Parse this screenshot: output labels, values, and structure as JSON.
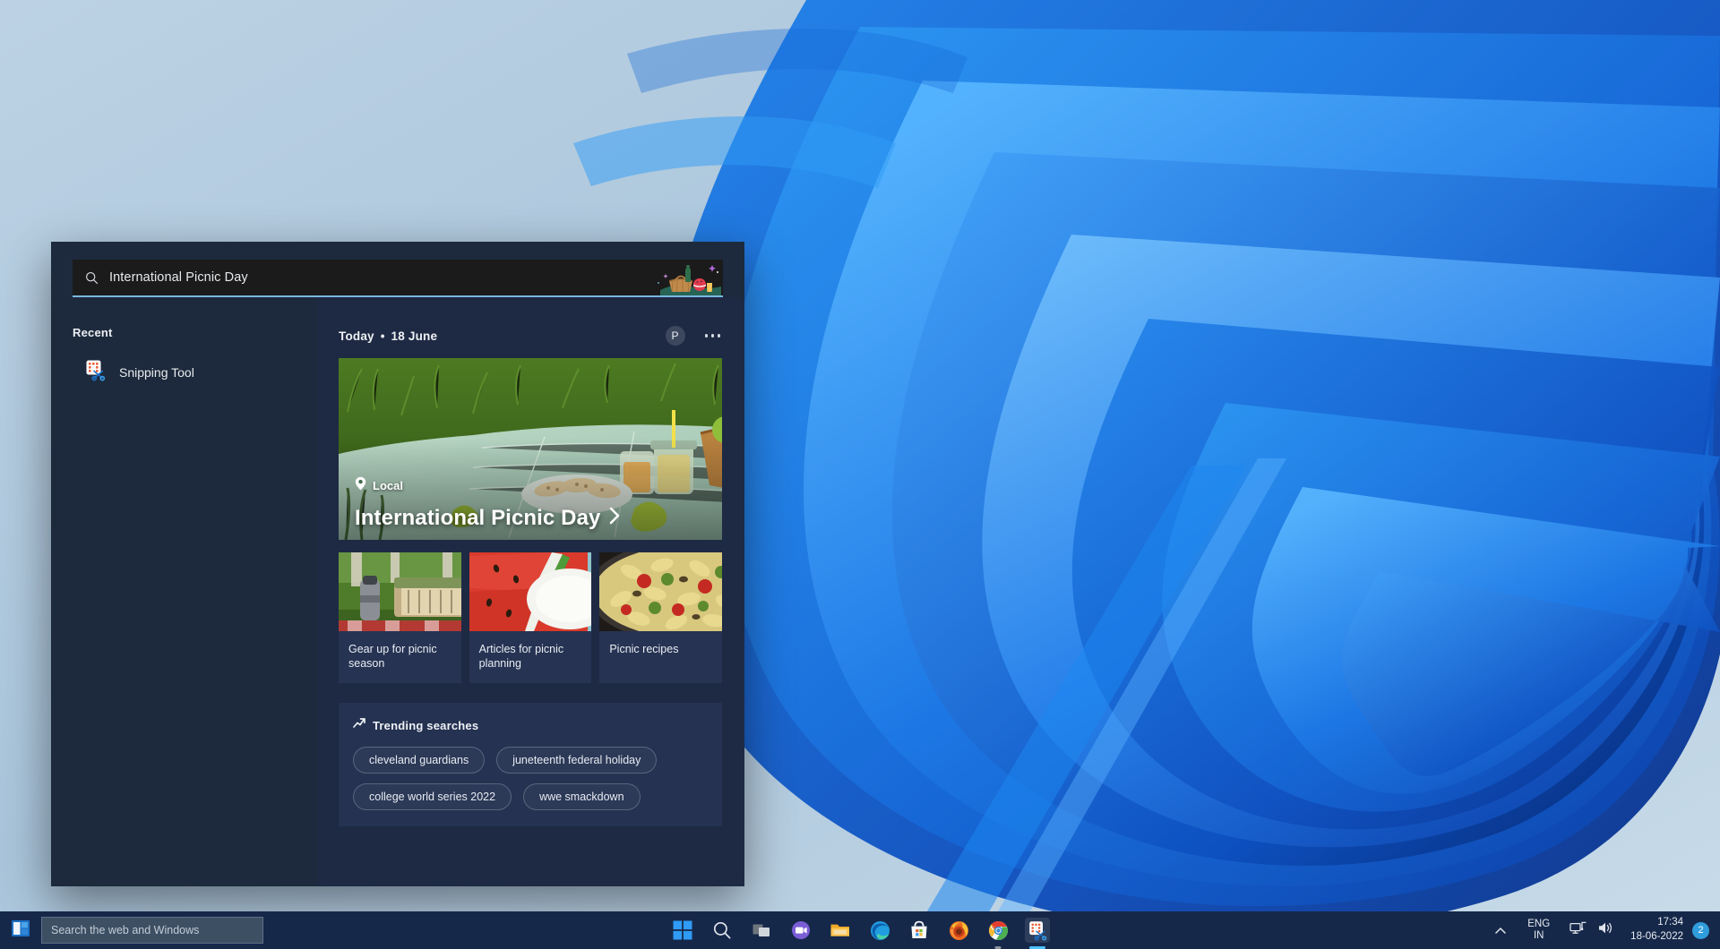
{
  "search_panel": {
    "search_input": {
      "value": "International Picnic Day",
      "placeholder": "Search the web and Windows",
      "icon": "search-icon",
      "art": "picnic-basket-illustration"
    },
    "left": {
      "section_label": "Recent",
      "items": [
        {
          "label": "Snipping Tool",
          "icon": "snipping-tool-icon"
        }
      ]
    },
    "right": {
      "today_label": "Today",
      "today_separator": "•",
      "today_date": "18 June",
      "avatar_initial": "P",
      "more_button": "more-options",
      "hero": {
        "badge_label": "Local",
        "badge_icon": "location-pin-icon",
        "title": "International Picnic Day",
        "chevron": "›"
      },
      "cards": [
        {
          "label": "Gear up for picnic season",
          "thumb": "picnic-basket-photo"
        },
        {
          "label": "Articles for picnic planning",
          "thumb": "watermelon-checkered-cloth-photo"
        },
        {
          "label": "Picnic recipes",
          "thumb": "pasta-salad-photo"
        }
      ],
      "trending": {
        "title": "Trending searches",
        "icon": "trending-up-icon",
        "chips": [
          "cleveland guardians",
          "juneteenth federal holiday",
          "college world series 2022",
          "wwe smackdown"
        ]
      }
    }
  },
  "taskbar": {
    "start_left_icon": "windows-logo-icon",
    "search_box": {
      "placeholder": "Search the web and Windows",
      "value": ""
    },
    "center_icons": [
      {
        "name": "start-icon",
        "label": "Start"
      },
      {
        "name": "search-icon",
        "label": "Search"
      },
      {
        "name": "task-view-icon",
        "label": "Task View"
      },
      {
        "name": "chat-icon",
        "label": "Chat"
      },
      {
        "name": "file-explorer-icon",
        "label": "File Explorer"
      },
      {
        "name": "edge-icon",
        "label": "Microsoft Edge"
      },
      {
        "name": "microsoft-store-icon",
        "label": "Microsoft Store"
      },
      {
        "name": "firefox-icon",
        "label": "Firefox"
      },
      {
        "name": "chrome-icon",
        "label": "Google Chrome"
      },
      {
        "name": "snipping-tool-icon",
        "label": "Snipping Tool"
      }
    ],
    "tray": {
      "chevron": "show-hidden-icons",
      "language_primary": "ENG",
      "language_secondary": "IN",
      "network_icon": "network-icon",
      "volume_icon": "volume-icon",
      "time": "17:34",
      "date": "18-06-2022",
      "notification_count": "2"
    }
  },
  "colors": {
    "panel_bg": "#1d2a3d",
    "content_bg": "#1e2a44",
    "card_bg": "#263353",
    "accent": "#79b8e0",
    "taskbar_bg": "#16284a",
    "notification_badge": "#2f9cdb"
  }
}
